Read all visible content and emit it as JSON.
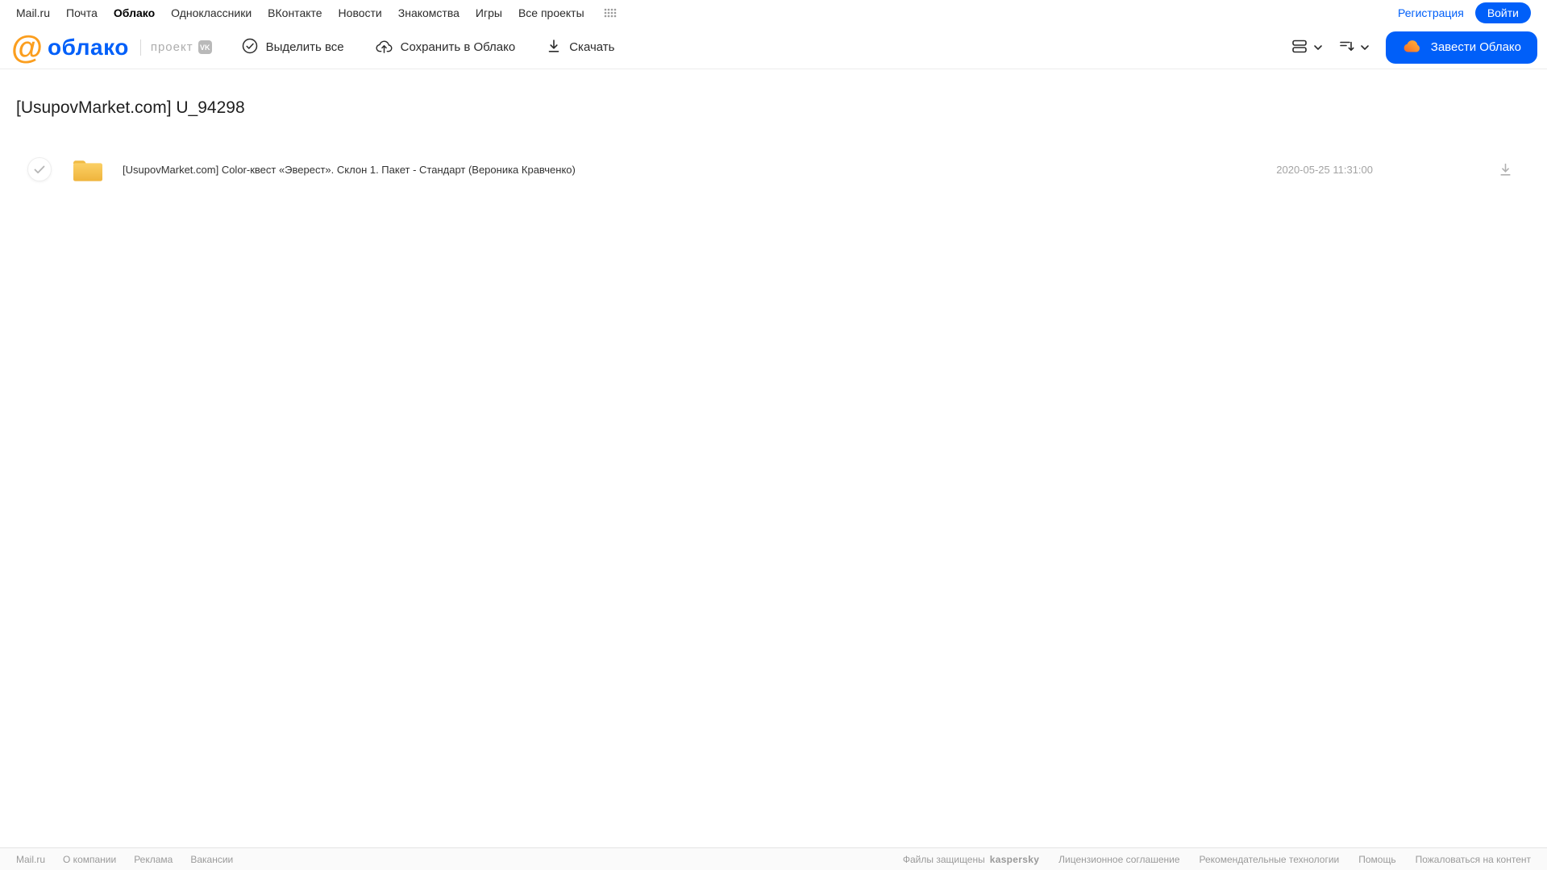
{
  "portal_nav": {
    "items": [
      "Mail.ru",
      "Почта",
      "Облако",
      "Одноклассники",
      "ВКонтакте",
      "Новости",
      "Знакомства",
      "Игры",
      "Все проекты"
    ],
    "active_item": "Облако",
    "registration_label": "Регистрация",
    "login_label": "Войти"
  },
  "header": {
    "logo_text": "облако",
    "project_label": "проект",
    "toolbar": {
      "select_all_label": "Выделить все",
      "save_to_cloud_label": "Сохранить в Облако",
      "download_label": "Скачать"
    },
    "get_cloud_label": "Завести Облако"
  },
  "main": {
    "title": "[UsupovMarket.com] U_94298",
    "files": [
      {
        "type": "folder",
        "name": "[UsupovMarket.com] Color-квест «Эверест». Склон 1. Пакет - Стандарт (Вероника Кравченко)",
        "date": "2020-05-25 11:31:00"
      }
    ]
  },
  "footer": {
    "left_links": [
      "Mail.ru",
      "О компании",
      "Реклама",
      "Вакансии"
    ],
    "protected_text": "Файлы защищены",
    "kaspersky_label": "kaspersky",
    "right_links": [
      "Лицензионное соглашение",
      "Рекомендательные технологии",
      "Помощь",
      "Пожаловаться на контент"
    ]
  },
  "colors": {
    "brand_blue": "#005FF9",
    "brand_orange": "#FB9E1E",
    "folder_yellow": "#F5C14E",
    "kaspersky_green": "#00A88E"
  }
}
